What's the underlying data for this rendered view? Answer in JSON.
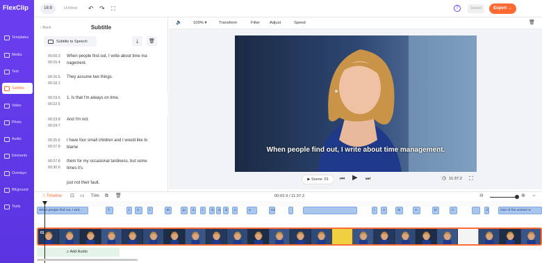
{
  "app": {
    "logo": "FlexClip",
    "ratio": "16:9",
    "title": "Untitled",
    "saved_label": "Saved",
    "export_label": "Export",
    "accent": "#6a3ff0",
    "export_color": "#ff6b35"
  },
  "sidebar": {
    "items": [
      {
        "label": "Templates",
        "icon": "templates-icon"
      },
      {
        "label": "Media",
        "icon": "media-icon"
      },
      {
        "label": "Text",
        "icon": "text-icon"
      },
      {
        "label": "Subtitle",
        "icon": "subtitle-icon",
        "active": true
      },
      {
        "label": "Video",
        "icon": "video-icon"
      },
      {
        "label": "Photo",
        "icon": "photo-icon"
      },
      {
        "label": "Audio",
        "icon": "audio-icon"
      },
      {
        "label": "Elements",
        "icon": "elements-icon"
      },
      {
        "label": "Overlays",
        "icon": "overlays-icon"
      },
      {
        "label": "BKground",
        "icon": "background-icon"
      },
      {
        "label": "Tools",
        "icon": "tools-icon"
      }
    ]
  },
  "subtitle_panel": {
    "back_label": "Back",
    "title": "Subtitle",
    "speech_button": "Subtitle to Speech",
    "items": [
      {
        "start": "00:00.0",
        "end": "00:15.4",
        "text": "When people find out, I write about time ma nagement."
      },
      {
        "start": "00:16.6",
        "end": "00:18.1",
        "text": "They assume two things."
      },
      {
        "start": "00:19.6",
        "end": "00:22.5",
        "text": "1. Is that I'm always on time."
      },
      {
        "start": "00:23.8",
        "end": "00:24.7",
        "text": "And I'm not."
      },
      {
        "start": "00:25.6",
        "end": "00:27.8",
        "text": "I have four small children and I would like to blame"
      },
      {
        "start": "00:27.8",
        "end": "00:30.6",
        "text": "them for my occasional tardiness, but some times it's"
      },
      {
        "start": "",
        "end": "",
        "text": "just not their fault."
      }
    ]
  },
  "preview": {
    "toolbar": {
      "zoom": "100%",
      "transform": "Transform",
      "filter": "Filter",
      "adjust": "Adjust",
      "speed": "Speed"
    },
    "caption": "When people find out, I write about time management.",
    "scene_label": "Scene: 01",
    "duration": "11:37.2"
  },
  "timeline": {
    "label": "Timeline",
    "trim_label": "Trim",
    "time_display": "00:02.9 / 11:37.2",
    "subtitle_chips": [
      {
        "text": "When people find out, I writ..."
      },
      {
        "text": "T"
      },
      {
        "text": "I."
      },
      {
        "text": "A"
      },
      {
        "text": "I"
      },
      {
        "text": "th"
      },
      {
        "text": "ju"
      },
      {
        "text": "s"
      },
      {
        "text": "I"
      },
      {
        "text": "S"
      },
      {
        "text": "a"
      },
      {
        "text": "S"
      },
      {
        "text": "o"
      },
      {
        "text": "a"
      },
      {
        "text": "minutes to exercise"
      },
      {
        "text": "i"
      },
      {
        "text": "A"
      },
      {
        "text": "Si"
      },
      {
        "text": "A"
      },
      {
        "text": "D"
      },
      {
        "text": "A"
      },
      {
        "text": "C"
      },
      {
        "text": "One of the women w"
      }
    ],
    "clip_badge": "01",
    "add_audio_label": "Add Audio"
  }
}
